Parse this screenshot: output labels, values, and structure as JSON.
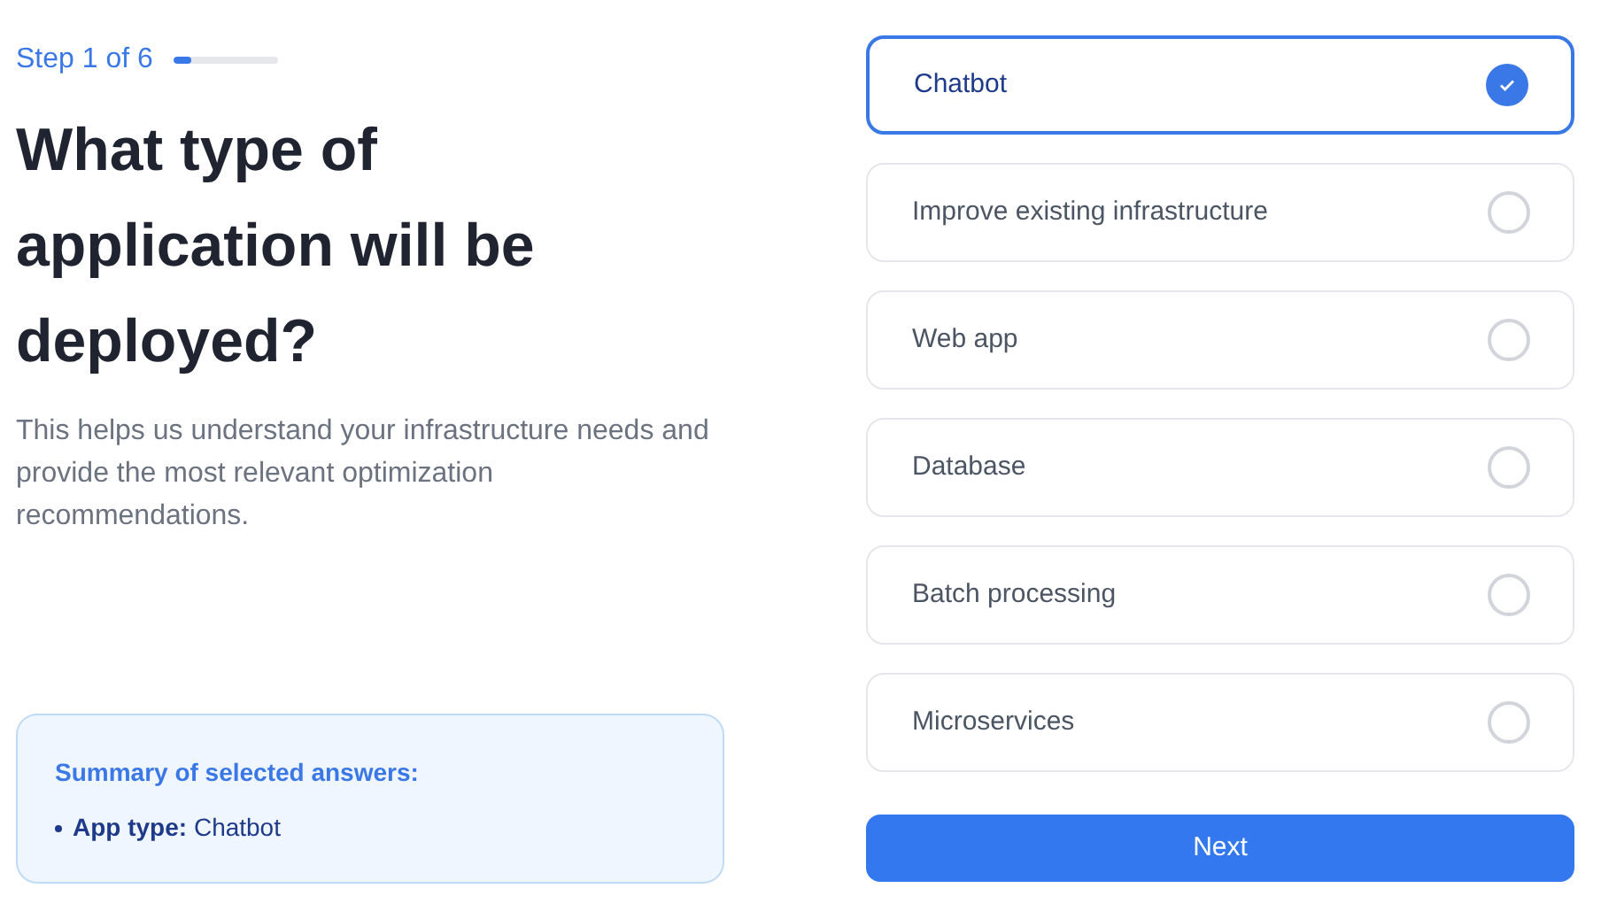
{
  "step": {
    "label": "Step 1 of 6",
    "level": 0.17
  },
  "heading": "What type of application will be deployed?",
  "description": "This helps us understand your infrastructure needs and provide the most relevant optimization recommendations.",
  "summary": {
    "title": "Summary of selected answers:",
    "items": [
      "**App type:** Chatbot"
    ]
  },
  "options": [
    {
      "label": "Chatbot",
      "selected": true
    },
    {
      "label": "Improve existing infrastructure",
      "selected": false
    },
    {
      "label": "Web app",
      "selected": false
    },
    {
      "label": "Database",
      "selected": false
    },
    {
      "label": "Batch processing",
      "selected": false
    },
    {
      "label": "Microservices",
      "selected": false
    }
  ],
  "next_button": "Next"
}
